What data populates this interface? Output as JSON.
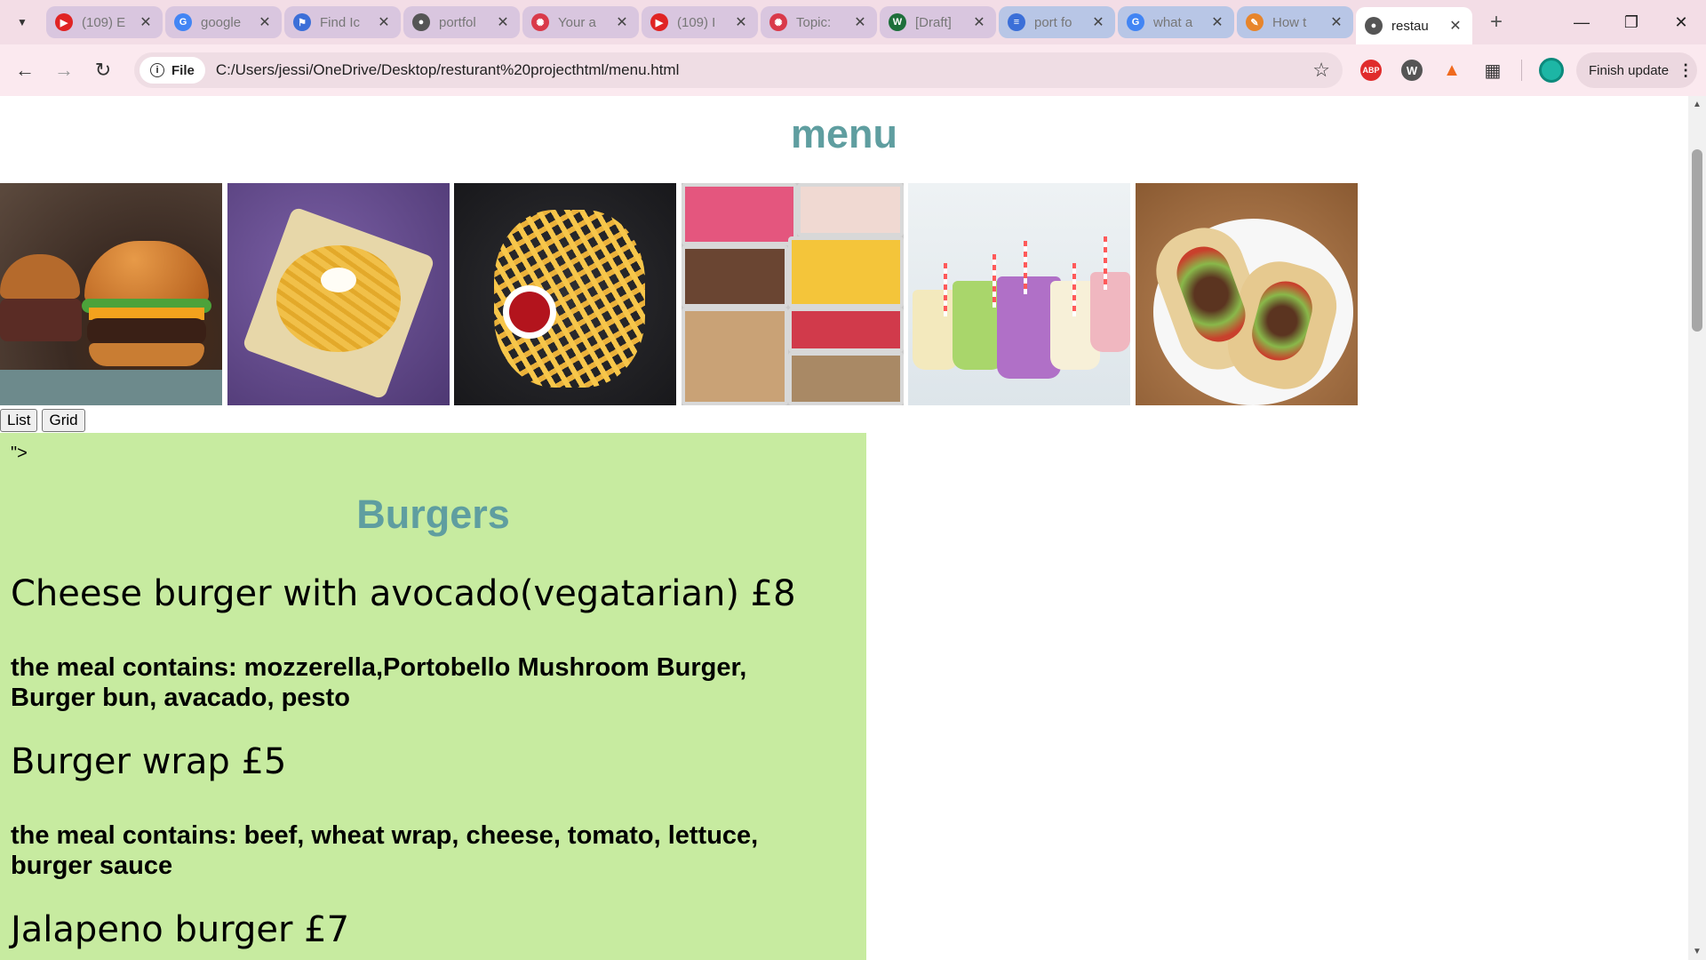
{
  "browser": {
    "tabs": [
      {
        "title": "(109) E",
        "favicon": "youtube-icon",
        "color": "#e02424",
        "state": "tinted"
      },
      {
        "title": "google",
        "favicon": "google-icon",
        "color": "#4285f4",
        "state": "tinted"
      },
      {
        "title": "Find Ic",
        "favicon": "flag-icon",
        "color": "#3b6fd8",
        "state": "tinted"
      },
      {
        "title": "portfol",
        "favicon": "globe-icon",
        "color": "#555555",
        "state": "tinted"
      },
      {
        "title": "Your a",
        "favicon": "aperture-icon",
        "color": "#d93a4a",
        "state": "tinted"
      },
      {
        "title": "(109) I",
        "favicon": "youtube-icon",
        "color": "#e02424",
        "state": "tinted"
      },
      {
        "title": "Topic:",
        "favicon": "aperture-icon",
        "color": "#d93a4a",
        "state": "tinted"
      },
      {
        "title": "[Draft]",
        "favicon": "w3schools-icon",
        "color": "#1e6f3b",
        "state": "tinted"
      },
      {
        "title": "port fo",
        "favicon": "docs-icon",
        "color": "#3b6fd8",
        "state": "blue-tinted"
      },
      {
        "title": "what a",
        "favicon": "google-icon",
        "color": "#4285f4",
        "state": "blue-tinted"
      },
      {
        "title": "How t",
        "favicon": "pen-icon",
        "color": "#e7852b",
        "state": "blue-tinted"
      },
      {
        "title": "restau",
        "favicon": "globe-icon",
        "color": "#555555",
        "state": "active"
      }
    ],
    "site_chip": "File",
    "url": "C:/Users/jessi/OneDrive/Desktop/resturant%20projecthtml/menu.html",
    "finish_update": "Finish update",
    "extensions": {
      "abp": "ABP",
      "wp": "W"
    }
  },
  "page": {
    "title": "menu",
    "gallery": [
      {
        "alt": "burgers",
        "kind": "p-burgers"
      },
      {
        "alt": "loaded fries",
        "kind": "p-fries-bowl"
      },
      {
        "alt": "fries with ketchup",
        "kind": "p-fries-ketchup"
      },
      {
        "alt": "gelato trays",
        "kind": "p-gelato"
      },
      {
        "alt": "smoothies",
        "kind": "p-smoothies"
      },
      {
        "alt": "burrito wrap",
        "kind": "p-wrap"
      }
    ],
    "buttons": {
      "list": "List",
      "grid": "Grid"
    },
    "stray_text": "\">",
    "section": {
      "title": "Burgers",
      "items": [
        {
          "name": "Cheese burger with avocado(vegatarian) £8",
          "desc": "the meal contains: mozzerella,Portobello Mushroom Burger, Burger bun, avacado, pesto"
        },
        {
          "name": "Burger wrap £5",
          "desc": "the meal contains: beef, wheat wrap, cheese, tomato, lettuce, burger sauce"
        },
        {
          "name": "Jalapeno burger £7",
          "desc": ""
        }
      ]
    }
  },
  "colors": {
    "title": "#5f9ea0",
    "section_bg": "#c7eba0",
    "tabbar_bg": "#f3dde6"
  }
}
